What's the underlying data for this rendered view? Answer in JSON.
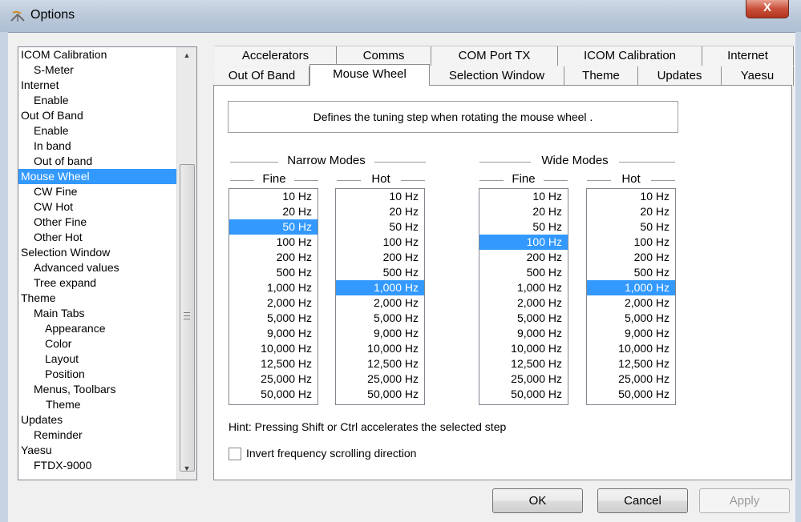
{
  "window": {
    "title": "Options",
    "close_label": "X",
    "title_icon": "satellite-dish-icon"
  },
  "tree": {
    "items": [
      {
        "label": "ICOM Calibration",
        "level": 0
      },
      {
        "label": "S-Meter",
        "level": 1
      },
      {
        "label": "Internet",
        "level": 0
      },
      {
        "label": "Enable",
        "level": 1
      },
      {
        "label": "Out Of Band",
        "level": 0
      },
      {
        "label": "Enable",
        "level": 1
      },
      {
        "label": "In band",
        "level": 1
      },
      {
        "label": "Out of band",
        "level": 1
      },
      {
        "label": "Mouse Wheel",
        "level": 0,
        "selected": true
      },
      {
        "label": "CW Fine",
        "level": 1
      },
      {
        "label": "CW Hot",
        "level": 1
      },
      {
        "label": "Other Fine",
        "level": 1
      },
      {
        "label": "Other Hot",
        "level": 1
      },
      {
        "label": "Selection Window",
        "level": 0
      },
      {
        "label": "Advanced values",
        "level": 1
      },
      {
        "label": "Tree expand",
        "level": 1
      },
      {
        "label": "Theme",
        "level": 0
      },
      {
        "label": "Main Tabs",
        "level": 1
      },
      {
        "label": "Appearance",
        "level": 2
      },
      {
        "label": "Color",
        "level": 2
      },
      {
        "label": "Layout",
        "level": 2
      },
      {
        "label": "Position",
        "level": 2
      },
      {
        "label": "Menus, Toolbars",
        "level": 1
      },
      {
        "label": "Theme",
        "level": 3
      },
      {
        "label": "Updates",
        "level": 0
      },
      {
        "label": "Reminder",
        "level": 1
      },
      {
        "label": "Yaesu",
        "level": 0
      },
      {
        "label": "FTDX-9000",
        "level": 1
      }
    ]
  },
  "tabs": {
    "row1": [
      "Accelerators",
      "Comms",
      "COM Port TX",
      "ICOM Calibration",
      "Internet"
    ],
    "row2": [
      "Out Of Band",
      "Mouse Wheel",
      "Selection Window",
      "Theme",
      "Updates",
      "Yaesu"
    ],
    "active": "Mouse Wheel"
  },
  "panel": {
    "description": "Defines the tuning step when rotating the mouse wheel .",
    "narrow_title": "Narrow Modes",
    "wide_title": "Wide Modes",
    "fine_label": "Fine",
    "hot_label": "Hot",
    "steps": [
      "10 Hz",
      "20 Hz",
      "50 Hz",
      "100 Hz",
      "200 Hz",
      "500 Hz",
      "1,000 Hz",
      "2,000 Hz",
      "5,000 Hz",
      "9,000 Hz",
      "10,000 Hz",
      "12,500 Hz",
      "25,000 Hz",
      "50,000 Hz"
    ],
    "lists": [
      {
        "group": "Narrow Modes",
        "label": "Fine",
        "selected": "50 Hz"
      },
      {
        "group": "Narrow Modes",
        "label": "Hot",
        "selected": "1,000 Hz"
      },
      {
        "group": "Wide Modes",
        "label": "Fine",
        "selected": "100 Hz"
      },
      {
        "group": "Wide Modes",
        "label": "Hot",
        "selected": "1,000 Hz"
      }
    ],
    "hint": "Hint: Pressing Shift or Ctrl accelerates the selected step",
    "invert_label": "Invert frequency scrolling direction",
    "invert_checked": false
  },
  "buttons": {
    "ok": "OK",
    "cancel": "Cancel",
    "apply": "Apply"
  },
  "colors": {
    "selection": "#3399ff",
    "close": "#c9503a"
  }
}
